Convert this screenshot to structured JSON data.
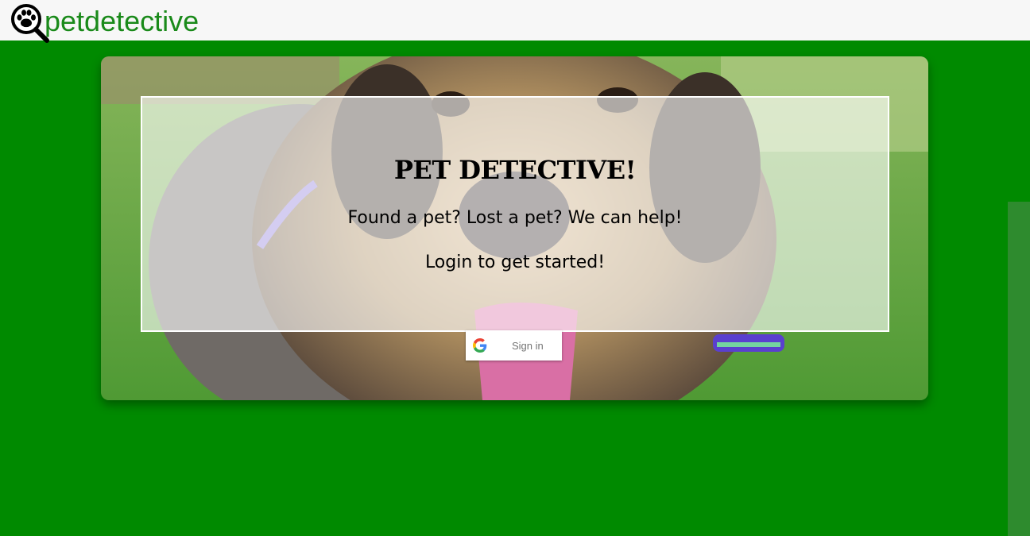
{
  "header": {
    "brand_name": "petdetective",
    "logo_icon": "paw-magnifier-icon"
  },
  "hero": {
    "title": "PET DETECTIVE!",
    "tagline": "Found a pet? Lost a pet? We can help!",
    "cta": "Login to get started!"
  },
  "signin": {
    "label": "Sign in",
    "icon": "google-g-icon"
  },
  "colors": {
    "page_background": "#008a00",
    "header_background": "#f7f7f7",
    "brand_text": "#1a8a1a",
    "scrollbar_track": "#2e8b2e"
  }
}
